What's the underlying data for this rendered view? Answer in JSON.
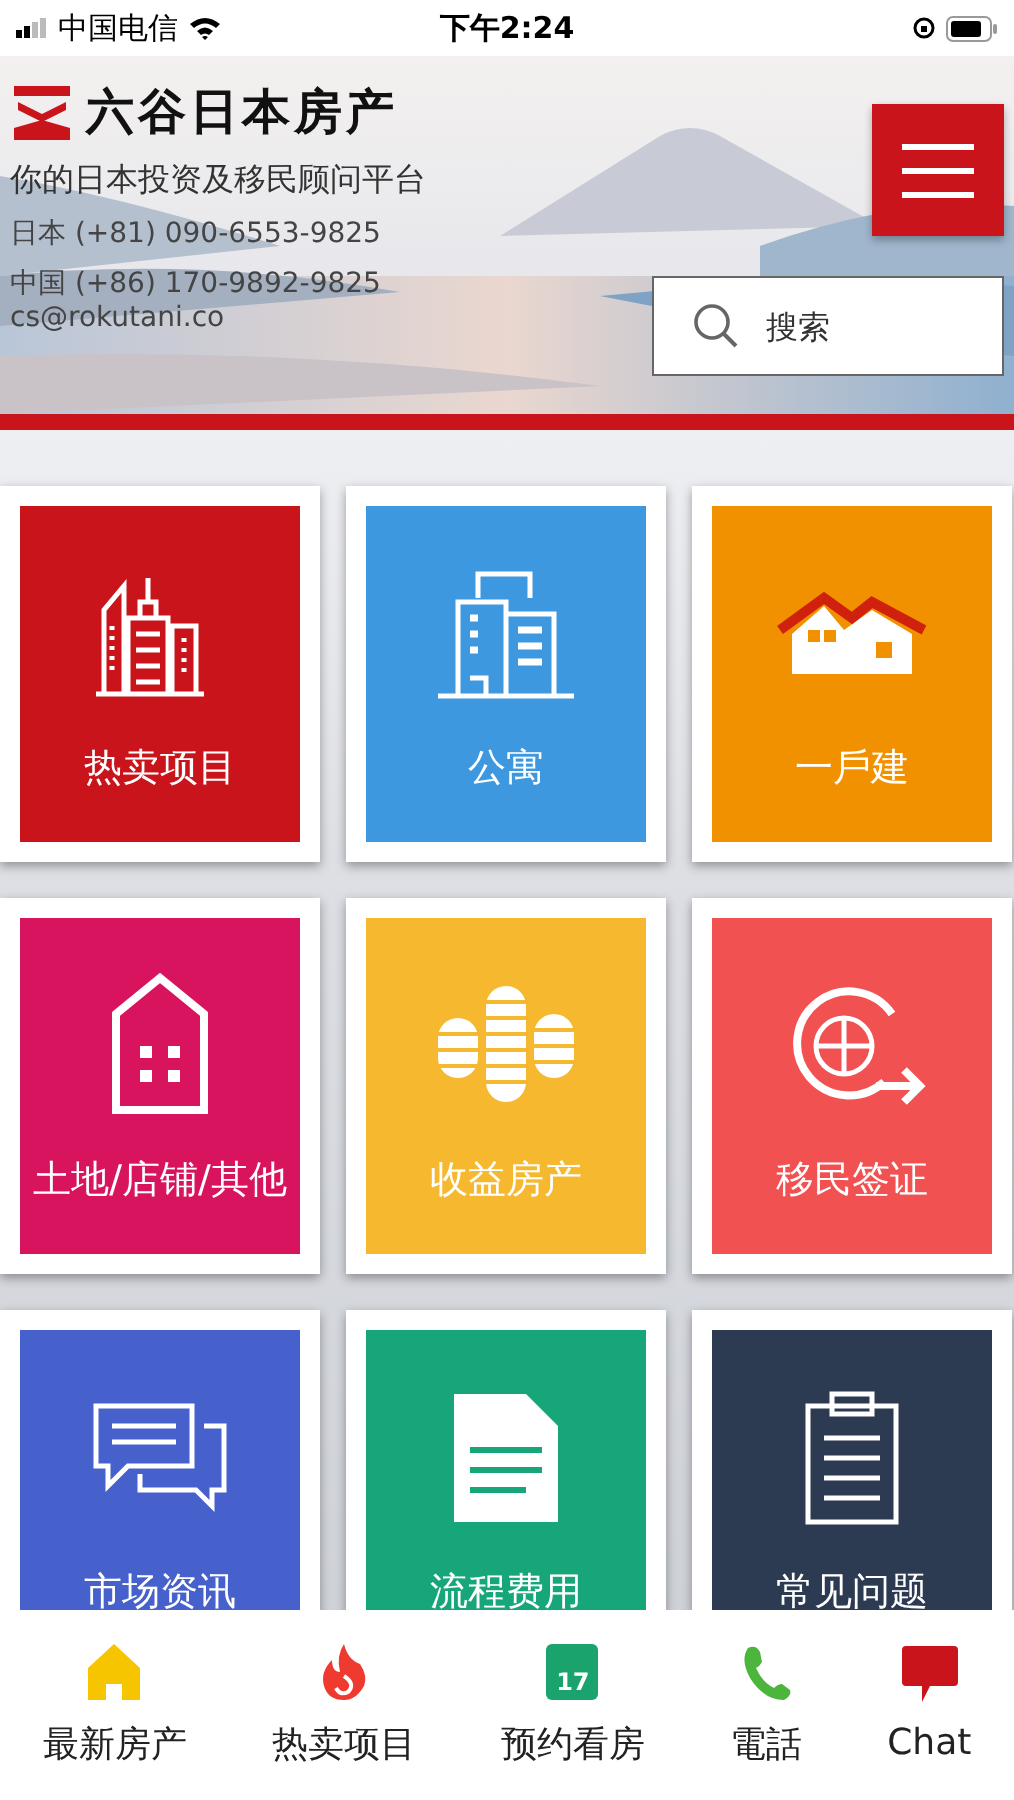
{
  "status_bar": {
    "carrier": "中国电信",
    "time": "下午2:24"
  },
  "header": {
    "brand": "六谷日本房产",
    "tagline": "你的日本投资及移民顾问平台",
    "phones": [
      "日本  (+81) 090-6553-9825",
      "中国 (+86) 170-9892-9825"
    ],
    "email": "cs@rokutani.co",
    "search": {
      "placeholder": "搜索"
    }
  },
  "tiles": [
    {
      "label": "热卖项目",
      "kind": "towers",
      "color": "#c8141a"
    },
    {
      "label": "公寓",
      "kind": "apartment",
      "color": "#3d98e0"
    },
    {
      "label": "一戶建",
      "kind": "house",
      "color": "#f29100"
    },
    {
      "label": "土地/店铺/其他",
      "kind": "building",
      "color": "#d8145f"
    },
    {
      "label": "收益房产",
      "kind": "coins",
      "color": "#f5b82e"
    },
    {
      "label": "移民签证",
      "kind": "globe",
      "color": "#f25152"
    },
    {
      "label": "市场资讯",
      "kind": "chat",
      "color": "#4660cc"
    },
    {
      "label": "流程费用",
      "kind": "document",
      "color": "#16a67a"
    },
    {
      "label": "常见问题",
      "kind": "clipboard",
      "color": "#2c3a52"
    }
  ],
  "bottom_nav": [
    {
      "label": "最新房产",
      "kind": "home"
    },
    {
      "label": "热卖项目",
      "kind": "flame"
    },
    {
      "label": "预约看房",
      "kind": "calendar",
      "day": "17"
    },
    {
      "label": "電話",
      "kind": "phone"
    },
    {
      "label": "Chat",
      "kind": "chat"
    }
  ]
}
